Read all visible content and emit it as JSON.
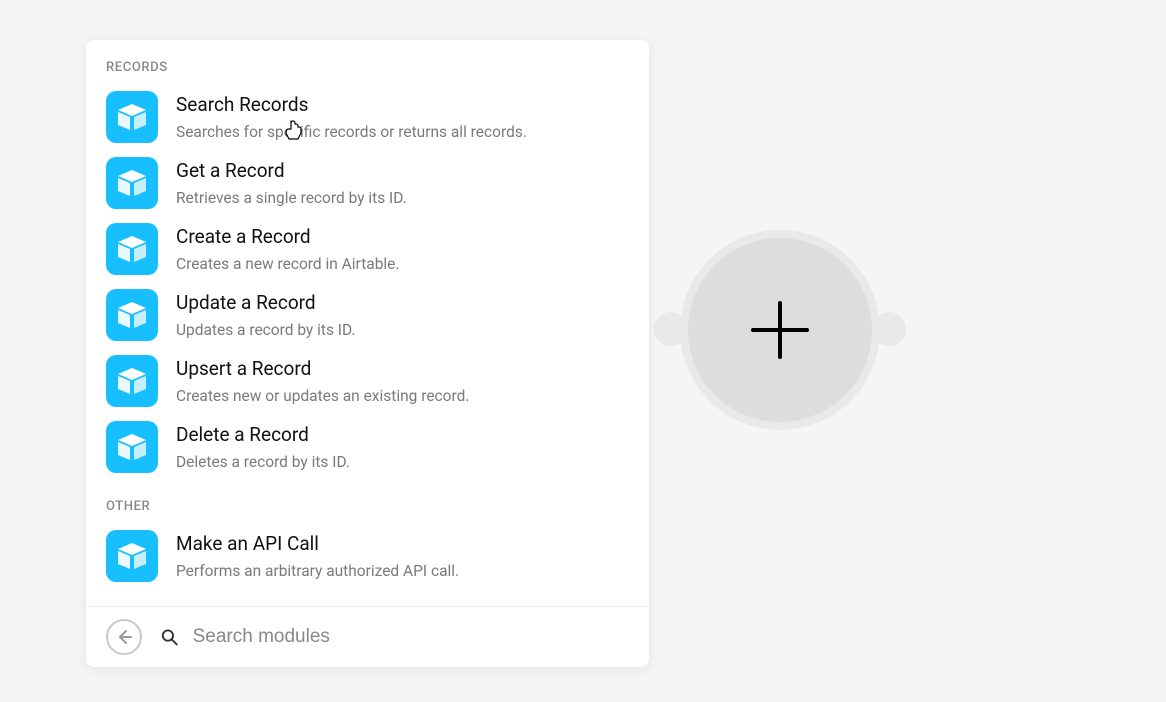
{
  "sections": [
    {
      "header": "RECORDS",
      "items": [
        {
          "title": "Search Records",
          "desc": "Searches for specific records or returns all records."
        },
        {
          "title": "Get a Record",
          "desc": "Retrieves a single record by its ID."
        },
        {
          "title": "Create a Record",
          "desc": "Creates a new record in Airtable."
        },
        {
          "title": "Update a Record",
          "desc": "Updates a record by its ID."
        },
        {
          "title": "Upsert a Record",
          "desc": "Creates new or updates an existing record."
        },
        {
          "title": "Delete a Record",
          "desc": "Deletes a record by its ID."
        }
      ]
    },
    {
      "header": "OTHER",
      "items": [
        {
          "title": "Make an API Call",
          "desc": "Performs an arbitrary authorized API call."
        }
      ]
    }
  ],
  "search": {
    "placeholder": "Search modules"
  }
}
